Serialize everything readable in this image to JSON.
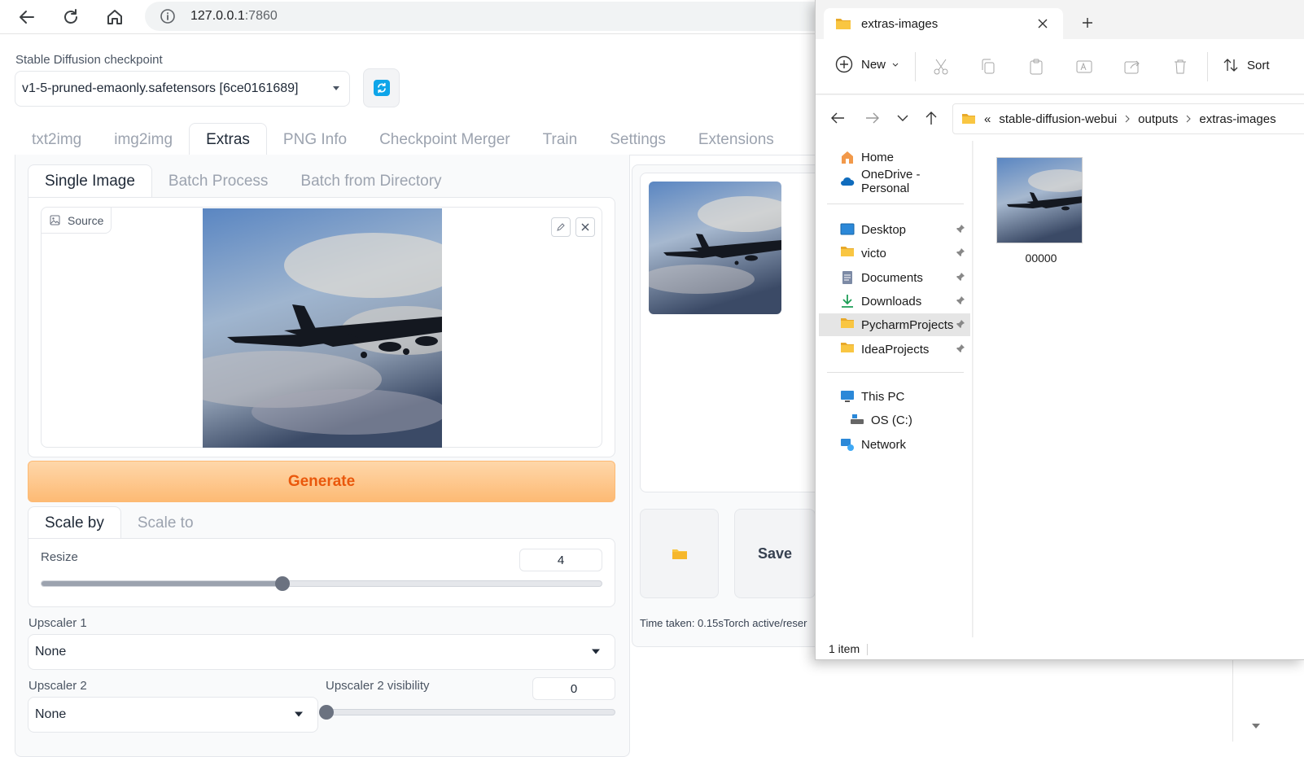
{
  "browser": {
    "url_host": "127.0.0.1",
    "url_port": ":7860"
  },
  "webui": {
    "checkpoint_label": "Stable Diffusion checkpoint",
    "checkpoint_value": "v1-5-pruned-emaonly.safetensors [6ce0161689]",
    "main_tabs": [
      {
        "label": "txt2img",
        "active": false
      },
      {
        "label": "img2img",
        "active": false
      },
      {
        "label": "Extras",
        "active": true
      },
      {
        "label": "PNG Info",
        "active": false
      },
      {
        "label": "Checkpoint Merger",
        "active": false
      },
      {
        "label": "Train",
        "active": false
      },
      {
        "label": "Settings",
        "active": false
      },
      {
        "label": "Extensions",
        "active": false
      }
    ],
    "sub_tabs": [
      {
        "label": "Single Image",
        "active": true
      },
      {
        "label": "Batch Process",
        "active": false
      },
      {
        "label": "Batch from Directory",
        "active": false
      }
    ],
    "source_label": "Source",
    "generate_label": "Generate",
    "scale_tabs": [
      {
        "label": "Scale by",
        "active": true
      },
      {
        "label": "Scale to",
        "active": false
      }
    ],
    "resize_label": "Resize",
    "resize_value": "4",
    "resize_fraction": 0.43,
    "upscaler1_label": "Upscaler 1",
    "upscaler1_value": "None",
    "upscaler2_label": "Upscaler 2",
    "upscaler2_value": "None",
    "upscaler2_visibility_label": "Upscaler 2 visibility",
    "upscaler2_visibility_value": "0",
    "upscaler2_visibility_fraction": 0.0,
    "save_label": "Save",
    "time_taken": "Time taken: 0.15sTorch active/reser"
  },
  "explorer": {
    "tab_title": "extras-images",
    "toolbar_new": "New",
    "toolbar_sort": "Sort",
    "breadcrumb": [
      "stable-diffusion-webui",
      "outputs",
      "extras-images"
    ],
    "breadcrumb_prefix": "«",
    "sidebar": {
      "home": "Home",
      "onedrive": "OneDrive - Personal",
      "desktop": "Desktop",
      "victo": "victo",
      "documents": "Documents",
      "downloads": "Downloads",
      "pycharm": "PycharmProjects",
      "idea": "IdeaProjects",
      "thispc": "This PC",
      "osc": "OS (C:)",
      "network": "Network"
    },
    "file_name": "00000",
    "status": "1 item"
  },
  "colors": {
    "generate_bg_top": "#fed7aa",
    "generate_bg_bottom": "#fdba74",
    "generate_text": "#ea580c",
    "refresh_icon": "#0ea5e9",
    "folder_yellow": "#f9c642"
  }
}
